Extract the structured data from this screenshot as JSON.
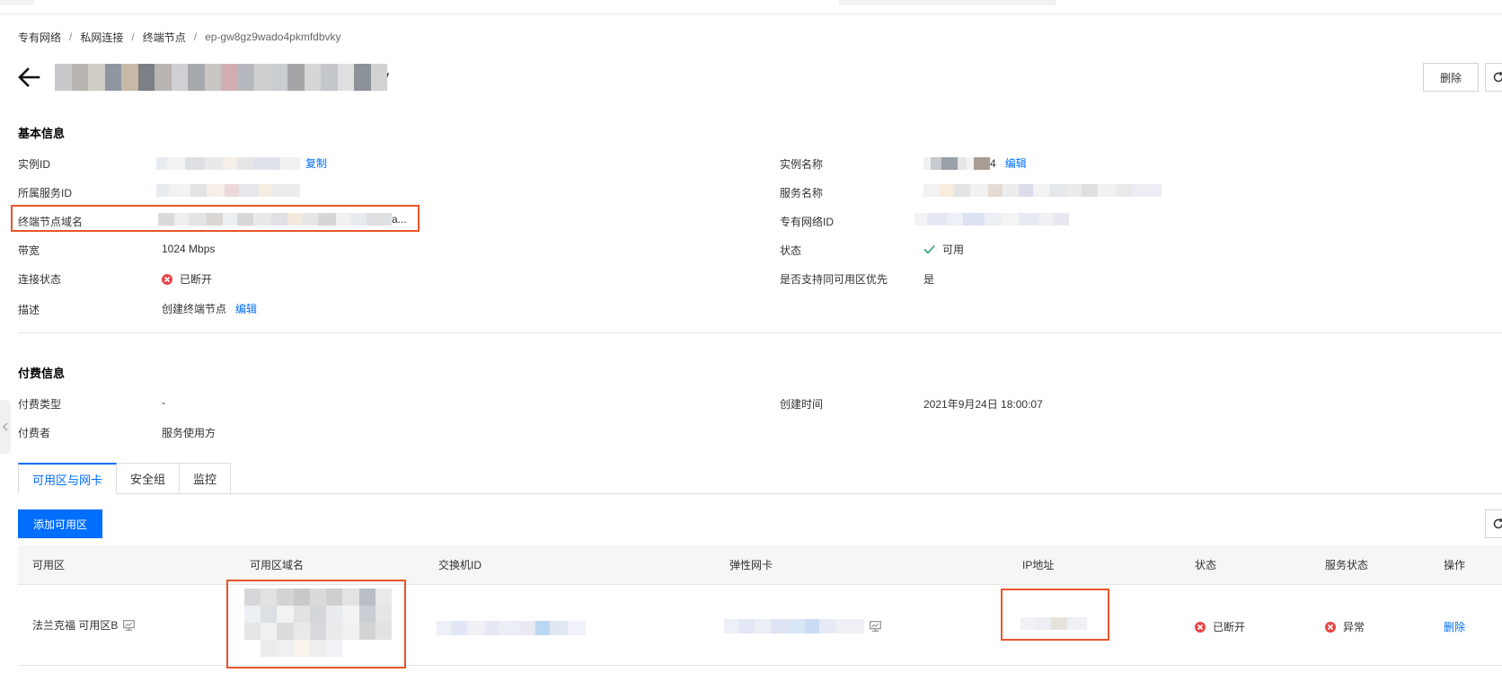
{
  "breadcrumb": [
    "专有网络",
    "私网连接",
    "终端节点",
    "ep-gw8gz9wado4pkmfdbvky"
  ],
  "title": "ep-gw8gz9wado4pkmfdbvky",
  "toolbar": {
    "delete_label": "删除"
  },
  "basic": {
    "section_title": "基本信息",
    "left": [
      {
        "label": "实例ID",
        "link": "复制"
      },
      {
        "label": "所属服务ID"
      },
      {
        "label": "终端节点域名",
        "value_tail": "a..."
      },
      {
        "label": "带宽",
        "value": "1024 Mbps"
      },
      {
        "label": "连接状态",
        "value": "已断开"
      },
      {
        "label": "描述",
        "value": "创建终端节点",
        "link": "编辑"
      }
    ],
    "right": [
      {
        "label": "实例名称",
        "value_tail": "4",
        "link": "编辑"
      },
      {
        "label": "服务名称"
      },
      {
        "label": "专有网络ID"
      },
      {
        "label": "状态",
        "value": "可用"
      },
      {
        "label": "是否支持同可用区优先",
        "value": "是"
      }
    ]
  },
  "billing": {
    "section_title": "付费信息",
    "left": [
      {
        "label": "付费类型",
        "value": "-"
      },
      {
        "label": "付费者",
        "value": "服务使用方"
      }
    ],
    "right": [
      {
        "label": "创建时间",
        "value": "2021年9月24日 18:00:07"
      }
    ]
  },
  "tabs": [
    "可用区与网卡",
    "安全组",
    "监控"
  ],
  "add_zone_label": "添加可用区",
  "table": {
    "headers": [
      "可用区",
      "可用区域名",
      "交换机ID",
      "弹性网卡",
      "IP地址",
      "状态",
      "服务状态",
      "操作"
    ],
    "rows": [
      {
        "zone": "法兰克福 可用区B",
        "status": "已断开",
        "service_status": "异常",
        "action": "删除"
      }
    ]
  },
  "colors": {
    "primary": "#006eff",
    "highlight": "#e8552b",
    "error": "#e54545",
    "success": "#2ba471"
  }
}
